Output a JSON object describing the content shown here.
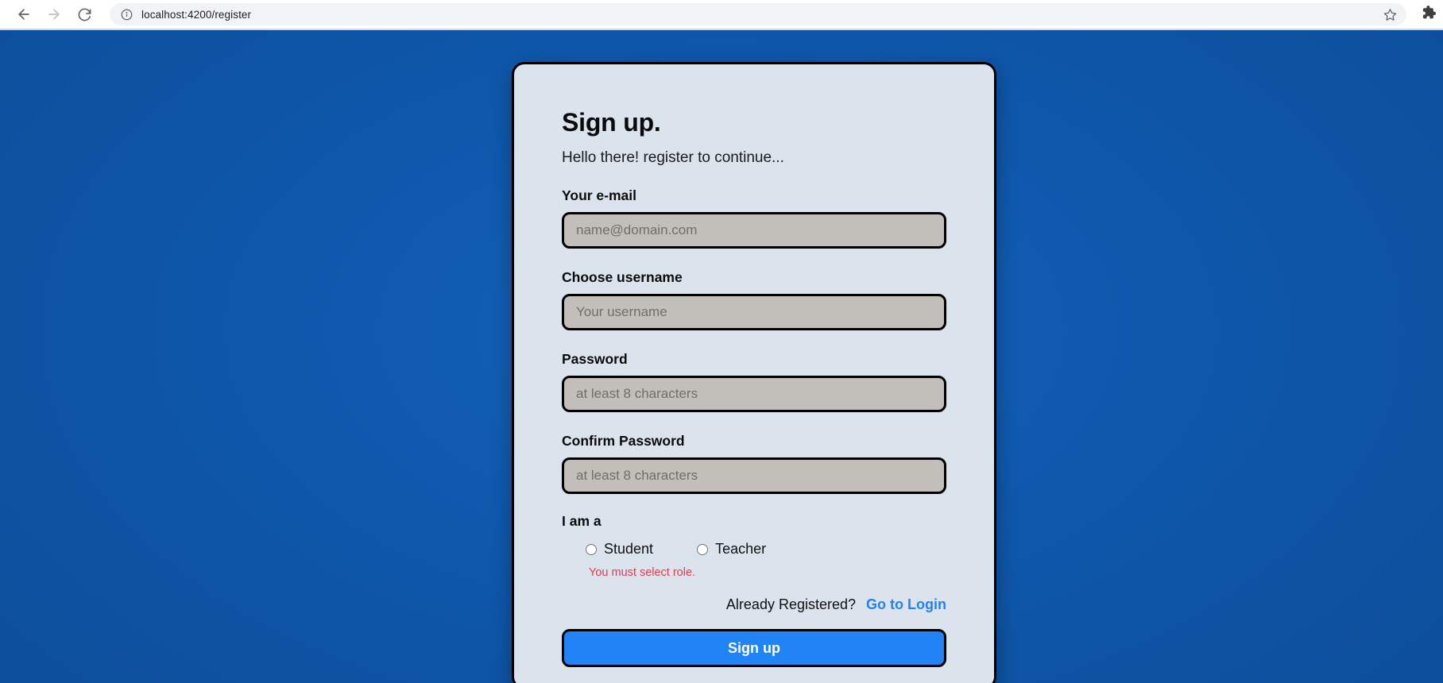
{
  "browser": {
    "back_icon": "arrow-left-icon",
    "forward_icon": "arrow-right-icon",
    "reload_icon": "reload-icon",
    "site_info_icon": "info-circle-icon",
    "url": "localhost:4200/register",
    "url_host": "localhost",
    "url_path": ":4200/register",
    "bookmark_icon": "star-icon",
    "extensions_icon": "puzzle-piece-icon"
  },
  "page": {
    "background_color": "#0f59ae",
    "card_background": "#dbe3ed"
  },
  "card": {
    "title": "Sign up.",
    "subtitle": "Hello there! register to continue...",
    "fields": [
      {
        "label": "Your e-mail",
        "placeholder": "name@domain.com",
        "value": "",
        "type": "email",
        "name": "email"
      },
      {
        "label": "Choose username",
        "placeholder": "Your username",
        "value": "",
        "type": "text",
        "name": "username"
      },
      {
        "label": "Password",
        "placeholder": "at least 8 characters",
        "value": "",
        "type": "password",
        "name": "password"
      },
      {
        "label": "Confirm Password",
        "placeholder": "at least 8 characters",
        "value": "",
        "type": "password",
        "name": "confirm-password"
      }
    ],
    "role": {
      "label": "I am a",
      "options": [
        {
          "label": "Student",
          "value": "student",
          "selected": false
        },
        {
          "label": "Teacher",
          "value": "teacher",
          "selected": false
        }
      ],
      "error": "You must select role.",
      "error_color": "#e8384f"
    },
    "login_prompt": "Already Registered?",
    "login_link": "Go to Login",
    "login_link_color": "#2083f6",
    "submit_label": "Sign up"
  }
}
